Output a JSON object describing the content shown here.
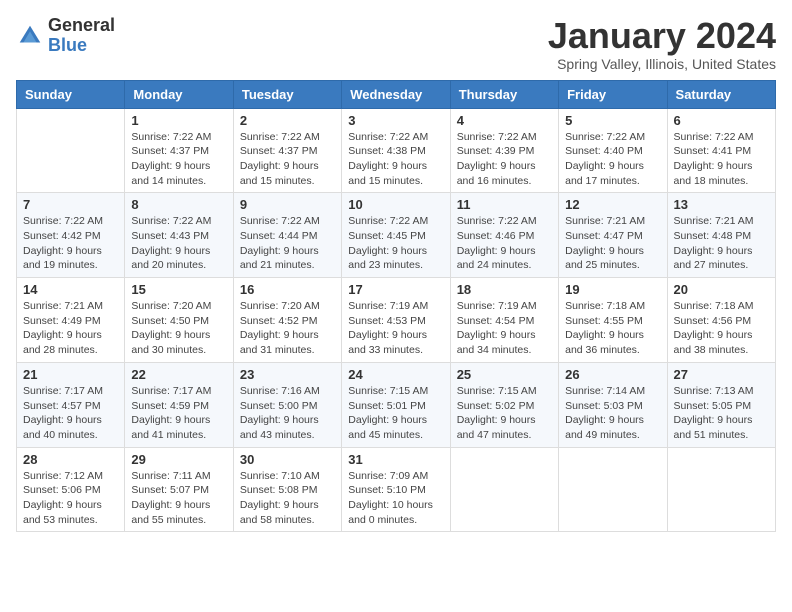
{
  "logo": {
    "general": "General",
    "blue": "Blue"
  },
  "title": "January 2024",
  "location": "Spring Valley, Illinois, United States",
  "weekdays": [
    "Sunday",
    "Monday",
    "Tuesday",
    "Wednesday",
    "Thursday",
    "Friday",
    "Saturday"
  ],
  "weeks": [
    [
      {
        "day": "",
        "sunrise": "",
        "sunset": "",
        "daylight": ""
      },
      {
        "day": "1",
        "sunrise": "Sunrise: 7:22 AM",
        "sunset": "Sunset: 4:37 PM",
        "daylight": "Daylight: 9 hours and 14 minutes."
      },
      {
        "day": "2",
        "sunrise": "Sunrise: 7:22 AM",
        "sunset": "Sunset: 4:37 PM",
        "daylight": "Daylight: 9 hours and 15 minutes."
      },
      {
        "day": "3",
        "sunrise": "Sunrise: 7:22 AM",
        "sunset": "Sunset: 4:38 PM",
        "daylight": "Daylight: 9 hours and 15 minutes."
      },
      {
        "day": "4",
        "sunrise": "Sunrise: 7:22 AM",
        "sunset": "Sunset: 4:39 PM",
        "daylight": "Daylight: 9 hours and 16 minutes."
      },
      {
        "day": "5",
        "sunrise": "Sunrise: 7:22 AM",
        "sunset": "Sunset: 4:40 PM",
        "daylight": "Daylight: 9 hours and 17 minutes."
      },
      {
        "day": "6",
        "sunrise": "Sunrise: 7:22 AM",
        "sunset": "Sunset: 4:41 PM",
        "daylight": "Daylight: 9 hours and 18 minutes."
      }
    ],
    [
      {
        "day": "7",
        "sunrise": "Sunrise: 7:22 AM",
        "sunset": "Sunset: 4:42 PM",
        "daylight": "Daylight: 9 hours and 19 minutes."
      },
      {
        "day": "8",
        "sunrise": "Sunrise: 7:22 AM",
        "sunset": "Sunset: 4:43 PM",
        "daylight": "Daylight: 9 hours and 20 minutes."
      },
      {
        "day": "9",
        "sunrise": "Sunrise: 7:22 AM",
        "sunset": "Sunset: 4:44 PM",
        "daylight": "Daylight: 9 hours and 21 minutes."
      },
      {
        "day": "10",
        "sunrise": "Sunrise: 7:22 AM",
        "sunset": "Sunset: 4:45 PM",
        "daylight": "Daylight: 9 hours and 23 minutes."
      },
      {
        "day": "11",
        "sunrise": "Sunrise: 7:22 AM",
        "sunset": "Sunset: 4:46 PM",
        "daylight": "Daylight: 9 hours and 24 minutes."
      },
      {
        "day": "12",
        "sunrise": "Sunrise: 7:21 AM",
        "sunset": "Sunset: 4:47 PM",
        "daylight": "Daylight: 9 hours and 25 minutes."
      },
      {
        "day": "13",
        "sunrise": "Sunrise: 7:21 AM",
        "sunset": "Sunset: 4:48 PM",
        "daylight": "Daylight: 9 hours and 27 minutes."
      }
    ],
    [
      {
        "day": "14",
        "sunrise": "Sunrise: 7:21 AM",
        "sunset": "Sunset: 4:49 PM",
        "daylight": "Daylight: 9 hours and 28 minutes."
      },
      {
        "day": "15",
        "sunrise": "Sunrise: 7:20 AM",
        "sunset": "Sunset: 4:50 PM",
        "daylight": "Daylight: 9 hours and 30 minutes."
      },
      {
        "day": "16",
        "sunrise": "Sunrise: 7:20 AM",
        "sunset": "Sunset: 4:52 PM",
        "daylight": "Daylight: 9 hours and 31 minutes."
      },
      {
        "day": "17",
        "sunrise": "Sunrise: 7:19 AM",
        "sunset": "Sunset: 4:53 PM",
        "daylight": "Daylight: 9 hours and 33 minutes."
      },
      {
        "day": "18",
        "sunrise": "Sunrise: 7:19 AM",
        "sunset": "Sunset: 4:54 PM",
        "daylight": "Daylight: 9 hours and 34 minutes."
      },
      {
        "day": "19",
        "sunrise": "Sunrise: 7:18 AM",
        "sunset": "Sunset: 4:55 PM",
        "daylight": "Daylight: 9 hours and 36 minutes."
      },
      {
        "day": "20",
        "sunrise": "Sunrise: 7:18 AM",
        "sunset": "Sunset: 4:56 PM",
        "daylight": "Daylight: 9 hours and 38 minutes."
      }
    ],
    [
      {
        "day": "21",
        "sunrise": "Sunrise: 7:17 AM",
        "sunset": "Sunset: 4:57 PM",
        "daylight": "Daylight: 9 hours and 40 minutes."
      },
      {
        "day": "22",
        "sunrise": "Sunrise: 7:17 AM",
        "sunset": "Sunset: 4:59 PM",
        "daylight": "Daylight: 9 hours and 41 minutes."
      },
      {
        "day": "23",
        "sunrise": "Sunrise: 7:16 AM",
        "sunset": "Sunset: 5:00 PM",
        "daylight": "Daylight: 9 hours and 43 minutes."
      },
      {
        "day": "24",
        "sunrise": "Sunrise: 7:15 AM",
        "sunset": "Sunset: 5:01 PM",
        "daylight": "Daylight: 9 hours and 45 minutes."
      },
      {
        "day": "25",
        "sunrise": "Sunrise: 7:15 AM",
        "sunset": "Sunset: 5:02 PM",
        "daylight": "Daylight: 9 hours and 47 minutes."
      },
      {
        "day": "26",
        "sunrise": "Sunrise: 7:14 AM",
        "sunset": "Sunset: 5:03 PM",
        "daylight": "Daylight: 9 hours and 49 minutes."
      },
      {
        "day": "27",
        "sunrise": "Sunrise: 7:13 AM",
        "sunset": "Sunset: 5:05 PM",
        "daylight": "Daylight: 9 hours and 51 minutes."
      }
    ],
    [
      {
        "day": "28",
        "sunrise": "Sunrise: 7:12 AM",
        "sunset": "Sunset: 5:06 PM",
        "daylight": "Daylight: 9 hours and 53 minutes."
      },
      {
        "day": "29",
        "sunrise": "Sunrise: 7:11 AM",
        "sunset": "Sunset: 5:07 PM",
        "daylight": "Daylight: 9 hours and 55 minutes."
      },
      {
        "day": "30",
        "sunrise": "Sunrise: 7:10 AM",
        "sunset": "Sunset: 5:08 PM",
        "daylight": "Daylight: 9 hours and 58 minutes."
      },
      {
        "day": "31",
        "sunrise": "Sunrise: 7:09 AM",
        "sunset": "Sunset: 5:10 PM",
        "daylight": "Daylight: 10 hours and 0 minutes."
      },
      {
        "day": "",
        "sunrise": "",
        "sunset": "",
        "daylight": ""
      },
      {
        "day": "",
        "sunrise": "",
        "sunset": "",
        "daylight": ""
      },
      {
        "day": "",
        "sunrise": "",
        "sunset": "",
        "daylight": ""
      }
    ]
  ]
}
